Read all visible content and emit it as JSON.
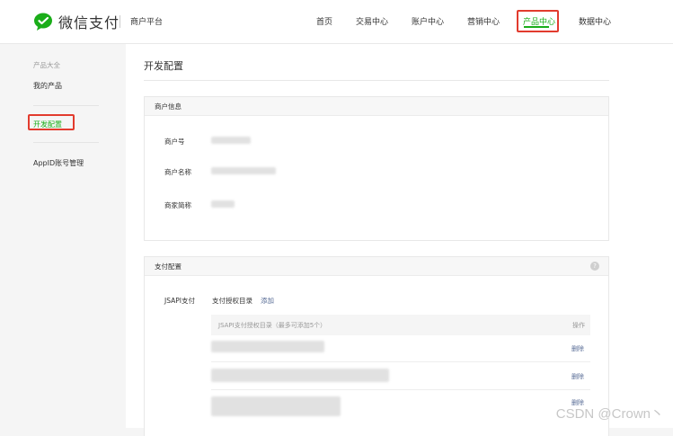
{
  "header": {
    "brand": "微信支付",
    "platform": "商户平台",
    "nav": [
      "首页",
      "交易中心",
      "账户中心",
      "营销中心",
      "产品中心",
      "数据中心"
    ],
    "active_nav": "产品中心",
    "brand_color": "#1aad19",
    "highlight_color": "#e23b2e"
  },
  "sidebar": {
    "category": "产品大全",
    "items": [
      "我的产品",
      "开发配置",
      "AppID账号管理"
    ],
    "active_item": "开发配置"
  },
  "main": {
    "title": "开发配置",
    "merchant_card": {
      "title": "商户信息",
      "fields": [
        "商户号",
        "商户名称",
        "商家简称"
      ]
    },
    "pay_card": {
      "title": "支付配置",
      "help_icon": "?",
      "row_label": "JSAPI支付",
      "dir_label": "支付授权目录",
      "add_link": "添加",
      "table_header": "JSAPI支付授权目录（最多可添加5个）",
      "op_header": "操作",
      "delete_label": "删除"
    }
  },
  "watermark": "CSDN @Crown丶"
}
